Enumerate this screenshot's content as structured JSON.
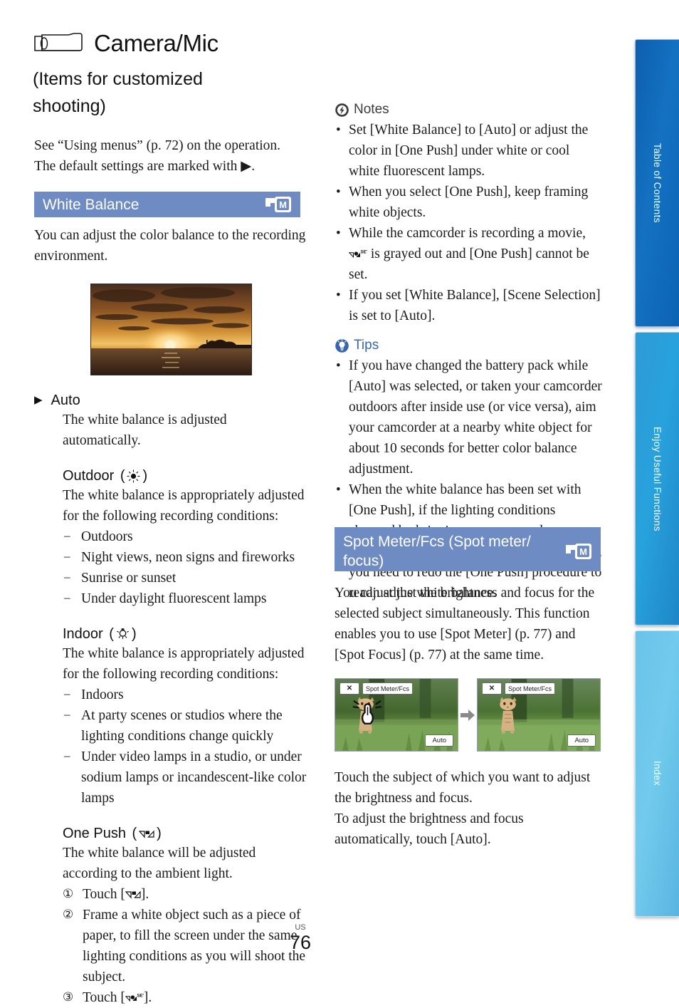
{
  "header": {
    "icon": "camcorder-icon",
    "title": "Camera/Mic",
    "subtitle": "(Items for customized shooting)",
    "intro_line1": "See “Using menus” (p. 72) on the operation.",
    "intro_line2_a": "The default settings are marked with ",
    "intro_line2_marker": "▶",
    "intro_line2_b": "."
  },
  "sections": {
    "white_balance": {
      "band_title": "White Balance",
      "band_icon": "manual-mode-icon",
      "intro": "You can adjust the color balance to the recording environment.",
      "photo_caption": "sunset-over-ocean-photo",
      "options": [
        {
          "marker": "▶",
          "name": "Auto",
          "icon": "",
          "body": "The white balance is adjusted automatically."
        },
        {
          "marker": "",
          "name": "Outdoor",
          "icon": "sun-icon",
          "body": "The white balance is appropriately adjusted for the following recording conditions:",
          "list": [
            "Outdoors",
            "Night views, neon signs and fireworks",
            "Sunrise or sunset",
            "Under daylight fluorescent lamps"
          ]
        },
        {
          "marker": "",
          "name": "Indoor",
          "icon": "light-bulb-icon",
          "body": "The white balance is appropriately adjusted for the following recording conditions:",
          "list": [
            "Indoors",
            "At party scenes or studios where the lighting conditions change quickly",
            "Under video lamps in a studio, or under sodium lamps or incandescent-like color lamps"
          ]
        },
        {
          "marker": "",
          "name": "One Push",
          "icon": "white-balance-icon",
          "body": "The white balance will be adjusted according to the ambient light.",
          "steps": [
            {
              "num": "①",
              "text_a": "Touch [",
              "glyph": "white-balance-icon",
              "text_b": "]."
            },
            {
              "num": "②",
              "text_a": "Frame a white object such as a piece of paper, to fill the screen under the same lighting conditions as you will shoot the subject.",
              "glyph": "",
              "text_b": ""
            },
            {
              "num": "③",
              "text_a": "Touch [",
              "glyph": "white-balance-set-icon",
              "text_b": "]."
            }
          ]
        }
      ]
    },
    "spot_meter": {
      "band_title": "Spot Meter/Fcs (Spot meter/ focus)",
      "band_icon": "manual-mode-icon",
      "intro": "You can adjust the brightness and focus for the selected subject simultaneously. This function enables you to use [Spot Meter] (p. 77) and [Spot Focus] (p. 77) at the same time.",
      "screenshots": [
        {
          "name": "kitten-touch-screenshot",
          "close_label": "✕",
          "title_label": "Spot Meter/Fcs",
          "auto_label": "Auto",
          "has_finger": true
        },
        {
          "name": "kitten-result-screenshot",
          "close_label": "✕",
          "title_label": "Spot Meter/Fcs",
          "auto_label": "Auto",
          "has_finger": false
        }
      ],
      "arrow": "➡",
      "outro_line1": "Touch the subject of which you want to adjust the brightness and focus.",
      "outro_line2": "To adjust the brightness and focus automatically, touch [Auto]."
    }
  },
  "callouts": {
    "notes": {
      "icon": "notes-lightning-icon",
      "label": "Notes",
      "items": [
        {
          "text_a": "Set [White Balance] to [Auto] or adjust the color in [One Push] under white or cool white fluorescent lamps.",
          "glyph": "",
          "text_b": ""
        },
        {
          "text_a": "When you select [One Push], keep framing white objects.",
          "glyph": "",
          "text_b": ""
        },
        {
          "text_a": "While the camcorder is recording a movie, ",
          "glyph": "white-balance-set-icon",
          "text_b": " is grayed out and [One Push] cannot be set."
        },
        {
          "text_a": "If you set [White Balance], [Scene Selection] is set to [Auto].",
          "glyph": "",
          "text_b": ""
        }
      ]
    },
    "tips": {
      "icon": "tips-bulb-icon",
      "label": "Tips",
      "items": [
        {
          "text_a": "If you have changed the battery pack while [Auto] was selected, or taken your camcorder outdoors after inside use (or vice versa), aim your camcorder at a nearby white object for about 10 seconds for better color balance adjustment.",
          "glyph": "",
          "text_b": ""
        },
        {
          "text_a": "When the white balance has been set with [One Push], if the lighting conditions changed by bringing your camcorder outdoors from inside the house, or vice versa, you need to redo the [One Push] procedure to readjust the white balance.",
          "glyph": "",
          "text_b": ""
        }
      ]
    }
  },
  "side_tabs": [
    {
      "name": "tab-table-of-contents",
      "label": "Table of Contents",
      "color": "#1471c2"
    },
    {
      "name": "tab-enjoy-useful-functions",
      "label": "Enjoy Useful Functions",
      "color": "#28a2dd"
    },
    {
      "name": "tab-index",
      "label": "Index",
      "color": "#72cbee"
    }
  ],
  "footer": {
    "region": "US",
    "page_number": "76"
  },
  "colors": {
    "band": "#6e8bc4",
    "tips_text": "#3a64ad",
    "notes_text": "#3b3b3b"
  }
}
